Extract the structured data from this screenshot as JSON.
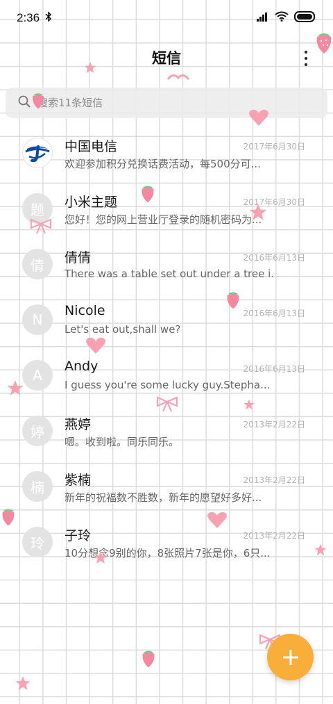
{
  "status_bar": {
    "time": "2:36",
    "icons": [
      "bluetooth-icon",
      "signal-icon",
      "wifi-icon",
      "battery-icon"
    ]
  },
  "header": {
    "title": "短信",
    "more_icon": "more-vertical-icon"
  },
  "search": {
    "placeholder": "搜索11条短信",
    "icon": "search-icon"
  },
  "conversations": [
    {
      "avatar": "",
      "avatar_type": "china-telecom-logo",
      "name": "中国电信",
      "date": "2017年6月30日",
      "preview": "欢迎参加积分兑换话费活动，每500分可..."
    },
    {
      "avatar": "题",
      "name": "小米主题",
      "date": "2017年6月30日",
      "preview": "您好！您的网上营业厅登录的随机密码为..."
    },
    {
      "avatar": "倩",
      "name": "倩倩",
      "date": "2016年6月13日",
      "preview": "There was a table set out under a tree i..."
    },
    {
      "avatar": "N",
      "name": "Nicole",
      "date": "2016年6月13日",
      "preview": "Let's eat out,shall we?"
    },
    {
      "avatar": "A",
      "name": "Andy",
      "date": "2016年6月13日",
      "preview": "I guess you're some lucky guy.Stepha..."
    },
    {
      "avatar": "婷",
      "name": "燕婷",
      "date": "2013年2月22日",
      "preview": "嗯。收到啦。同乐同乐。"
    },
    {
      "avatar": "楠",
      "name": "紫楠",
      "date": "2013年2月22日",
      "preview": "新年的祝福数不胜数，新年的愿望好多好..."
    },
    {
      "avatar": "玲",
      "name": "子玲",
      "date": "2013年2月22日",
      "preview": "10分想念9别的你，8张照片7张是你，6只..."
    }
  ],
  "fab": {
    "icon": "plus-icon"
  },
  "colors": {
    "accent": "#f8ae38",
    "telecom_blue": "#0a4aa5",
    "decoration_pink": "#f7a1b3"
  }
}
